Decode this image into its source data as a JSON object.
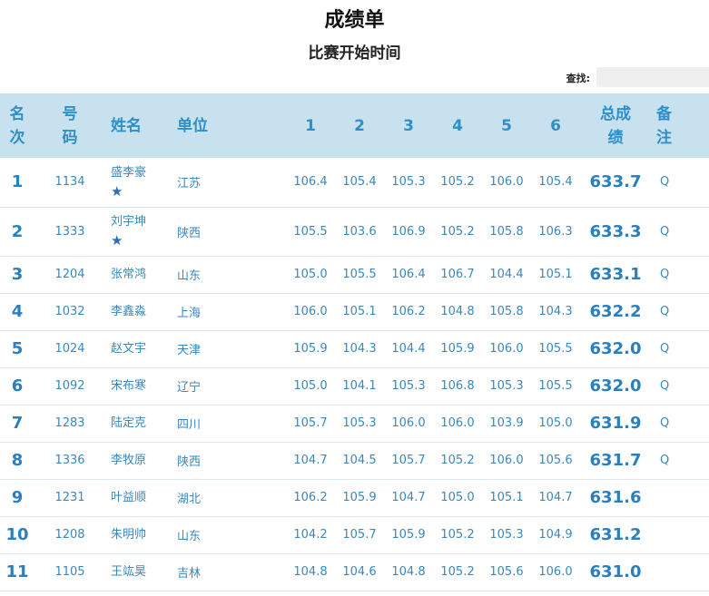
{
  "title": "成绩单",
  "subtitle": "比赛开始时间",
  "search": {
    "label": "查找:",
    "value": ""
  },
  "headers": {
    "rank": [
      "名",
      "次"
    ],
    "number": [
      "号",
      "码"
    ],
    "name": "姓名",
    "unit": "单位",
    "s1": "1",
    "s2": "2",
    "s3": "3",
    "s4": "4",
    "s5": "5",
    "s6": "6",
    "total": [
      "总成",
      "绩"
    ],
    "note": [
      "备",
      "注"
    ]
  },
  "rows": [
    {
      "rank": "1",
      "number": "1134",
      "name": "盛李豪",
      "star": "★",
      "unit": "江苏",
      "scores": [
        "106.4",
        "105.4",
        "105.3",
        "105.2",
        "106.0",
        "105.4"
      ],
      "total": "633.7",
      "note": "Q"
    },
    {
      "rank": "2",
      "number": "1333",
      "name": "刘宇坤",
      "star": "★",
      "unit": "陕西",
      "scores": [
        "105.5",
        "103.6",
        "106.9",
        "105.2",
        "105.8",
        "106.3"
      ],
      "total": "633.3",
      "note": "Q"
    },
    {
      "rank": "3",
      "number": "1204",
      "name": "张常鸿",
      "star": "",
      "unit": "山东",
      "scores": [
        "105.0",
        "105.5",
        "106.4",
        "106.7",
        "104.4",
        "105.1"
      ],
      "total": "633.1",
      "note": "Q"
    },
    {
      "rank": "4",
      "number": "1032",
      "name": "李鑫淼",
      "star": "",
      "unit": "上海",
      "scores": [
        "106.0",
        "105.1",
        "106.2",
        "104.8",
        "105.8",
        "104.3"
      ],
      "total": "632.2",
      "note": "Q"
    },
    {
      "rank": "5",
      "number": "1024",
      "name": "赵文宇",
      "star": "",
      "unit": "天津",
      "scores": [
        "105.9",
        "104.3",
        "104.4",
        "105.9",
        "106.0",
        "105.5"
      ],
      "total": "632.0",
      "note": "Q"
    },
    {
      "rank": "6",
      "number": "1092",
      "name": "宋布寒",
      "star": "",
      "unit": "辽宁",
      "scores": [
        "105.0",
        "104.1",
        "105.3",
        "106.8",
        "105.3",
        "105.5"
      ],
      "total": "632.0",
      "note": "Q"
    },
    {
      "rank": "7",
      "number": "1283",
      "name": "陆定克",
      "star": "",
      "unit": "四川",
      "scores": [
        "105.7",
        "105.3",
        "106.0",
        "106.0",
        "103.9",
        "105.0"
      ],
      "total": "631.9",
      "note": "Q"
    },
    {
      "rank": "8",
      "number": "1336",
      "name": "李牧原",
      "star": "",
      "unit": "陕西",
      "scores": [
        "104.7",
        "104.5",
        "105.7",
        "105.2",
        "106.0",
        "105.6"
      ],
      "total": "631.7",
      "note": "Q"
    },
    {
      "rank": "9",
      "number": "1231",
      "name": "叶益顺",
      "star": "",
      "unit": "湖北",
      "scores": [
        "106.2",
        "105.9",
        "104.7",
        "105.0",
        "105.1",
        "104.7"
      ],
      "total": "631.6",
      "note": ""
    },
    {
      "rank": "10",
      "number": "1208",
      "name": "朱明帅",
      "star": "",
      "unit": "山东",
      "scores": [
        "104.2",
        "105.7",
        "105.9",
        "105.2",
        "105.3",
        "104.9"
      ],
      "total": "631.2",
      "note": ""
    },
    {
      "rank": "11",
      "number": "1105",
      "name": "王竑昊",
      "star": "",
      "unit": "吉林",
      "scores": [
        "104.8",
        "104.6",
        "104.8",
        "105.2",
        "105.6",
        "106.0"
      ],
      "total": "631.0",
      "note": ""
    }
  ]
}
